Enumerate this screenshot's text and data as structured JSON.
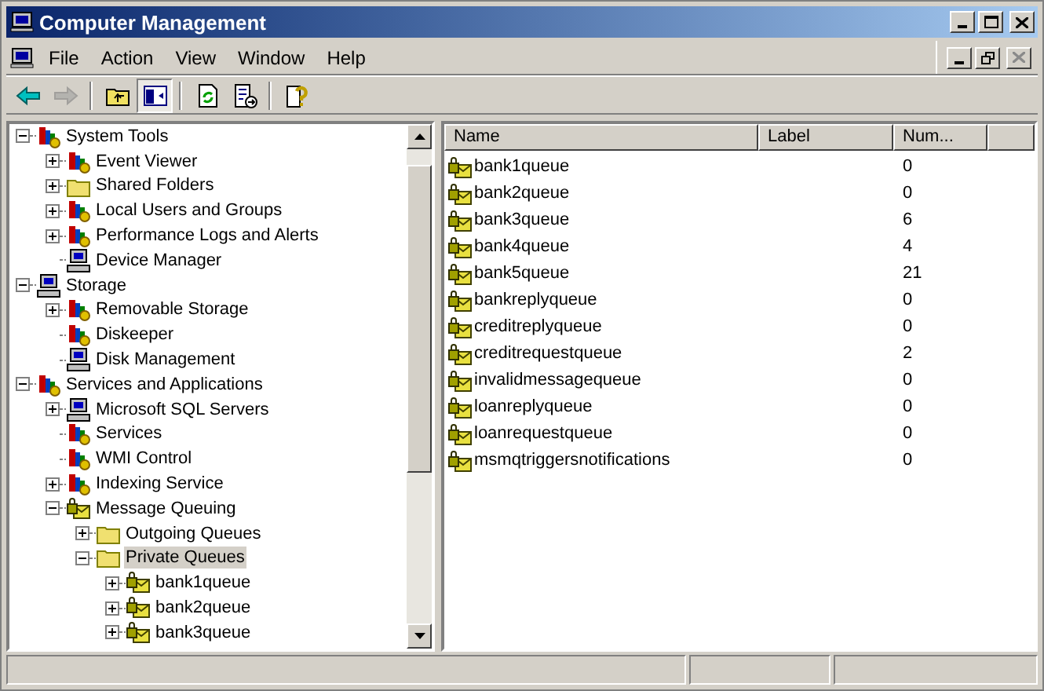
{
  "window": {
    "title": "Computer Management"
  },
  "menu": [
    "File",
    "Action",
    "View",
    "Window",
    "Help"
  ],
  "toolbar": [
    {
      "kind": "back",
      "disabled": false
    },
    {
      "kind": "forward",
      "disabled": true
    },
    {
      "kind": "sep"
    },
    {
      "kind": "up",
      "disabled": false
    },
    {
      "kind": "tree",
      "disabled": false,
      "pressed": true
    },
    {
      "kind": "sep"
    },
    {
      "kind": "refresh",
      "disabled": false
    },
    {
      "kind": "export",
      "disabled": false
    },
    {
      "kind": "sep"
    },
    {
      "kind": "help",
      "disabled": false
    }
  ],
  "tree": [
    {
      "label": "System Tools",
      "kind": "tool",
      "expanded": true,
      "selected": false,
      "children": [
        {
          "label": "Event Viewer",
          "kind": "tool",
          "expanded": false,
          "selected": false
        },
        {
          "label": "Shared Folders",
          "kind": "folder",
          "expanded": false,
          "selected": false
        },
        {
          "label": "Local Users and Groups",
          "kind": "tool",
          "expanded": false,
          "selected": false
        },
        {
          "label": "Performance Logs and Alerts",
          "kind": "tool",
          "expanded": false,
          "selected": false
        },
        {
          "label": "Device Manager",
          "kind": "computer",
          "selected": false
        }
      ]
    },
    {
      "label": "Storage",
      "kind": "computer",
      "expanded": true,
      "selected": false,
      "children": [
        {
          "label": "Removable Storage",
          "kind": "tool",
          "expanded": false,
          "selected": false
        },
        {
          "label": "Diskeeper",
          "kind": "tool",
          "selected": false
        },
        {
          "label": "Disk Management",
          "kind": "computer",
          "selected": false
        }
      ]
    },
    {
      "label": "Services and Applications",
      "kind": "tool",
      "expanded": true,
      "selected": false,
      "children": [
        {
          "label": "Microsoft SQL Servers",
          "kind": "computer",
          "expanded": false,
          "selected": false
        },
        {
          "label": "Services",
          "kind": "tool",
          "selected": false
        },
        {
          "label": "WMI Control",
          "kind": "tool",
          "selected": false
        },
        {
          "label": "Indexing Service",
          "kind": "tool",
          "expanded": false,
          "selected": false
        },
        {
          "label": "Message Queuing",
          "kind": "queue",
          "expanded": true,
          "selected": false,
          "children": [
            {
              "label": "Outgoing Queues",
              "kind": "folder",
              "expanded": false,
              "selected": false
            },
            {
              "label": "Private Queues",
              "kind": "folder",
              "expanded": true,
              "selected": true,
              "children": [
                {
                  "label": "bank1queue",
                  "kind": "queue",
                  "expanded": false,
                  "selected": false
                },
                {
                  "label": "bank2queue",
                  "kind": "queue",
                  "expanded": false,
                  "selected": false
                },
                {
                  "label": "bank3queue",
                  "kind": "queue",
                  "expanded": false,
                  "selected": false
                }
              ]
            }
          ]
        }
      ]
    }
  ],
  "list": {
    "columns": [
      "Name",
      "Label",
      "Num..."
    ],
    "rows": [
      {
        "name": "bank1queue",
        "count": "0"
      },
      {
        "name": "bank2queue",
        "count": "0"
      },
      {
        "name": "bank3queue",
        "count": "6"
      },
      {
        "name": "bank4queue",
        "count": "4"
      },
      {
        "name": "bank5queue",
        "count": "21"
      },
      {
        "name": "bankreplyqueue",
        "count": "0"
      },
      {
        "name": "creditreplyqueue",
        "count": "0"
      },
      {
        "name": "creditrequestqueue",
        "count": "2"
      },
      {
        "name": "invalidmessagequeue",
        "count": "0"
      },
      {
        "name": "loanreplyqueue",
        "count": "0"
      },
      {
        "name": "loanrequestqueue",
        "count": "0"
      },
      {
        "name": "msmqtriggersnotifications",
        "count": "0"
      }
    ]
  }
}
